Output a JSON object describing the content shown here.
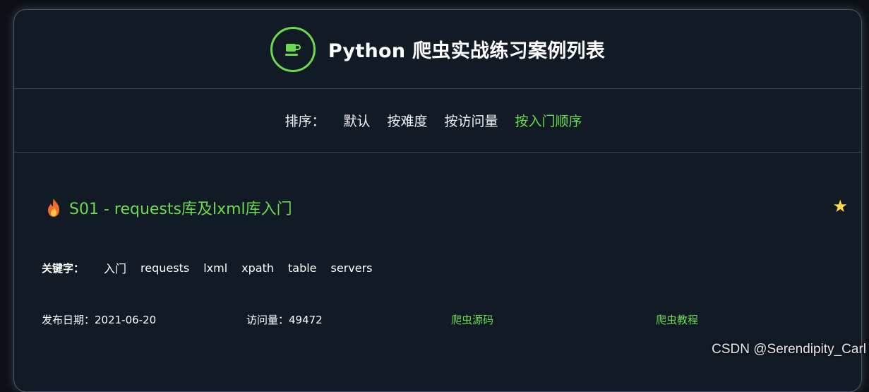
{
  "header": {
    "title": "Python 爬虫实战练习案例列表",
    "logo_icon": "coffee-cup-icon"
  },
  "sort": {
    "label": "排序：",
    "options": [
      "默认",
      "按难度",
      "按访问量",
      "按入门顺序"
    ],
    "active_option": "按入门顺序"
  },
  "item": {
    "title": "S01 - requests库及lxml库入门",
    "keywords_label": "关键字：",
    "keywords": [
      "入门",
      "requests",
      "lxml",
      "xpath",
      "table",
      "servers"
    ],
    "publish_date": "发布日期：2021-06-20",
    "visits": "访问量：49472",
    "source_link": "爬虫源码",
    "tutorial_link": "爬虫教程"
  },
  "watermark": "CSDN @Serendipity_Carl",
  "colors": {
    "accent": "#69db4f",
    "background": "#121a26",
    "star": "#ffd84a"
  }
}
